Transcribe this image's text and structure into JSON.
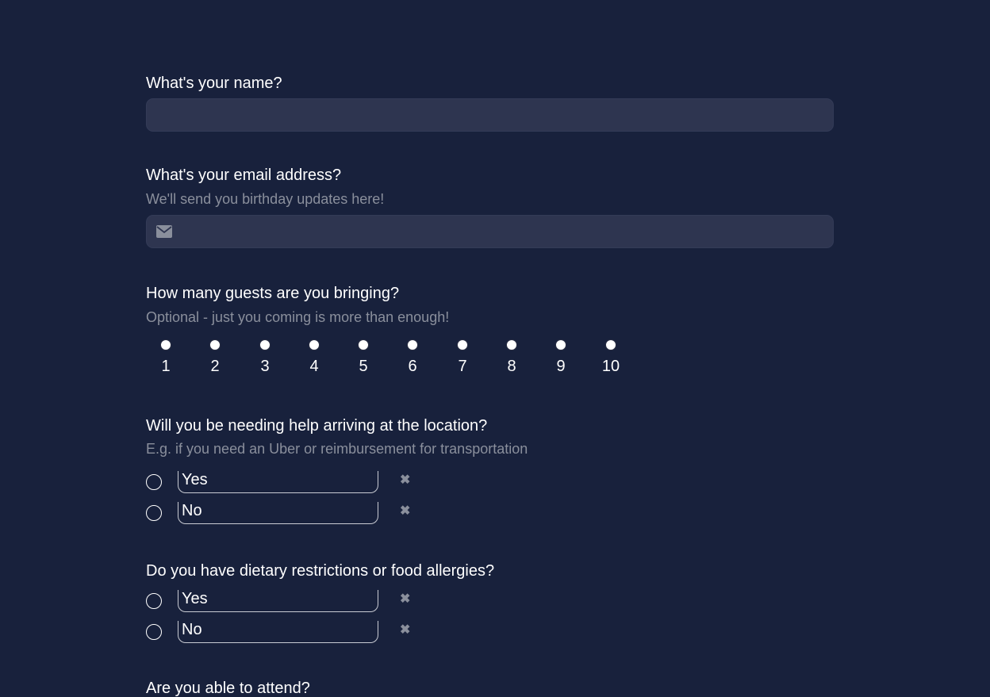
{
  "questions": {
    "name": {
      "label": "What's your name?",
      "value": "",
      "placeholder": ""
    },
    "email": {
      "label": "What's your email address?",
      "help": "We'll send you birthday updates here!",
      "value": "",
      "placeholder": "",
      "icon": "mail-icon"
    },
    "guests": {
      "label": "How many guests are you bringing?",
      "help": "Optional - just you coming is more than enough!",
      "options": [
        "1",
        "2",
        "3",
        "4",
        "5",
        "6",
        "7",
        "8",
        "9",
        "10"
      ]
    },
    "transport": {
      "label": "Will you be needing help arriving at the location?",
      "help": "E.g. if you need an Uber or reimbursement for transportation",
      "options": [
        "Yes",
        "No"
      ],
      "remove_glyph": "✖"
    },
    "dietary": {
      "label": "Do you have dietary restrictions or food allergies?",
      "options": [
        "Yes",
        "No"
      ],
      "remove_glyph": "✖"
    },
    "attend": {
      "label": "Are you able to attend?"
    }
  },
  "colors": {
    "background": "#18213c",
    "input_bg": "#2e3550",
    "text": "#ffffff",
    "muted": "#8a8f9c"
  }
}
